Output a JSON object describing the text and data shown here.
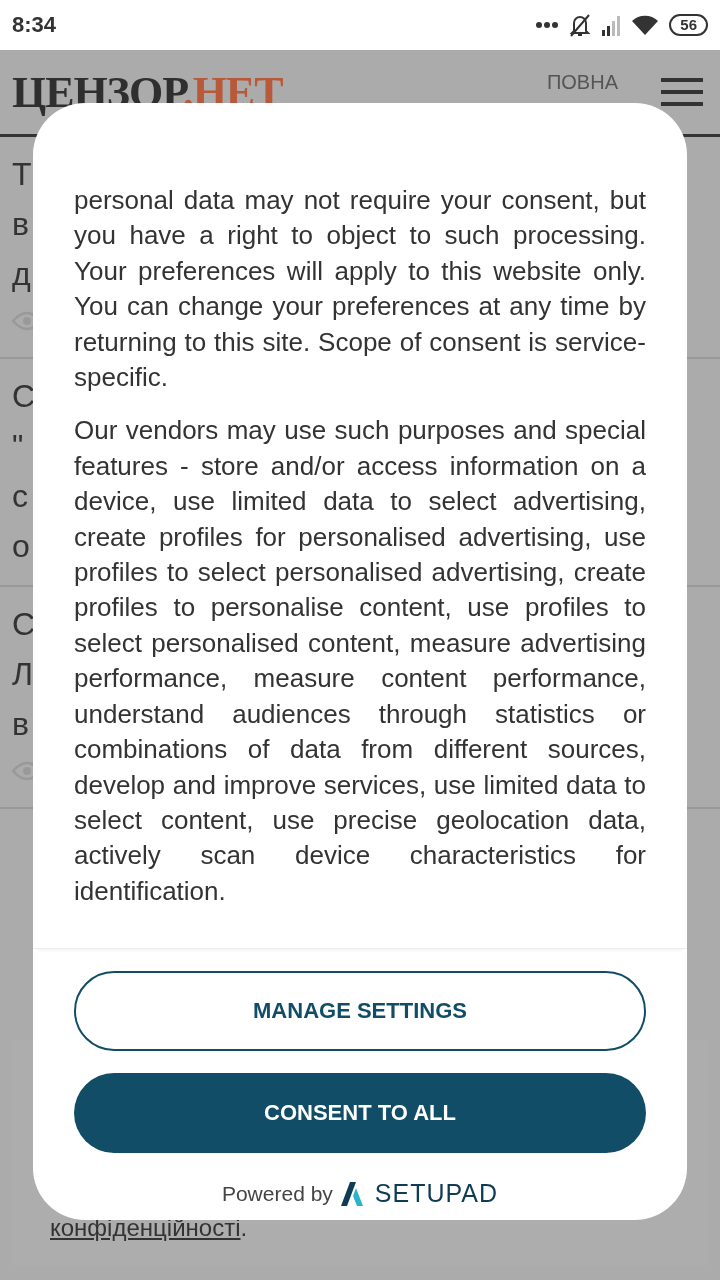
{
  "status_bar": {
    "time": "8:34",
    "battery": "56"
  },
  "header": {
    "logo_main": "ЦЕНЗОР",
    "logo_dot": ".",
    "logo_accent": "НЕТ",
    "full_version": [
      "ПОВНА"
    ]
  },
  "background_articles": [
    {
      "lines": [
        "Т",
        "в",
        "д"
      ],
      "views": true
    },
    {
      "lines": [
        "С",
        "\"",
        "с",
        "о"
      ],
      "views": false
    },
    {
      "lines": [
        "С",
        "Л",
        "в"
      ],
      "views": true
    }
  ],
  "background_notice": {
    "link": "конфіденційності",
    "tail": "."
  },
  "consent_dialog": {
    "paragraphs": [
      "personal data may not require your consent, but you have a right to object to such processing. Your preferences will apply to this website only. You can change your preferences at any time by returning to this site. Scope of consent is service-specific.",
      "Our vendors may use such purposes and special features - store and/or access information on a device, use limited data to select advertising, create profiles for personalised advertising, use profiles to select personalised advertising, create profiles to personalise content, use profiles to select personalised content, measure advertising performance, measure content performance, understand audiences through statistics or combinations of data from different sources, develop and improve services, use limited data to select content, use precise geolocation data, actively scan device characteristics for identification."
    ],
    "buttons": [
      {
        "label": "MANAGE SETTINGS",
        "kind": "outline"
      },
      {
        "label": "CONSENT TO ALL",
        "kind": "filled"
      }
    ],
    "powered_by": "Powered by",
    "brand": "SETUPAD"
  }
}
